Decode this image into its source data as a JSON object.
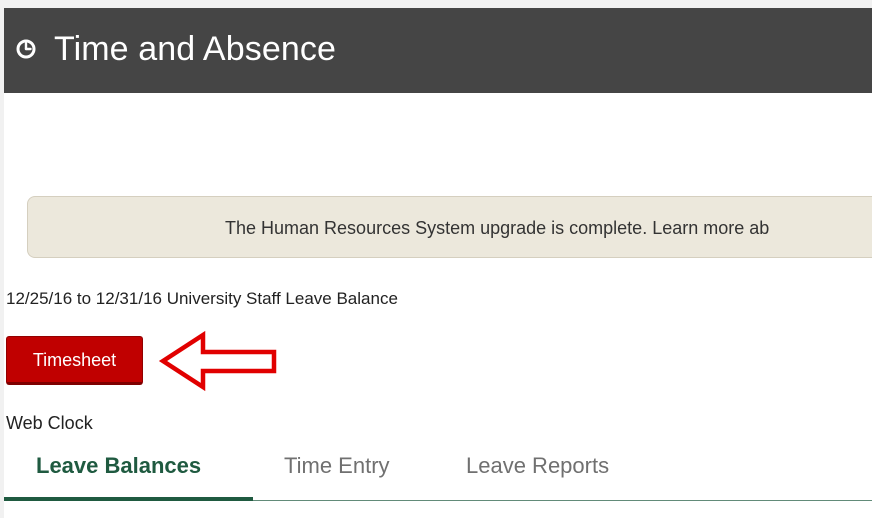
{
  "header": {
    "title": "Time and Absence",
    "icon": "clock-icon"
  },
  "notice": {
    "text": "The Human Resources System upgrade is complete. Learn more ab"
  },
  "leave_period": {
    "text": "12/25/16 to 12/31/16 University Staff Leave Balance"
  },
  "actions": {
    "timesheet_label": "Timesheet",
    "web_clock_label": "Web Clock"
  },
  "tabs": [
    {
      "label": "Leave Balances",
      "active": true
    },
    {
      "label": "Time Entry",
      "active": false
    },
    {
      "label": "Leave Reports",
      "active": false
    }
  ],
  "annotation": {
    "icon": "left-arrow-icon",
    "color": "#e10000"
  },
  "colors": {
    "header_background": "#454545",
    "button_red": "#c00000",
    "tab_green": "#1f5a40",
    "notice_background": "#ece8dc"
  }
}
